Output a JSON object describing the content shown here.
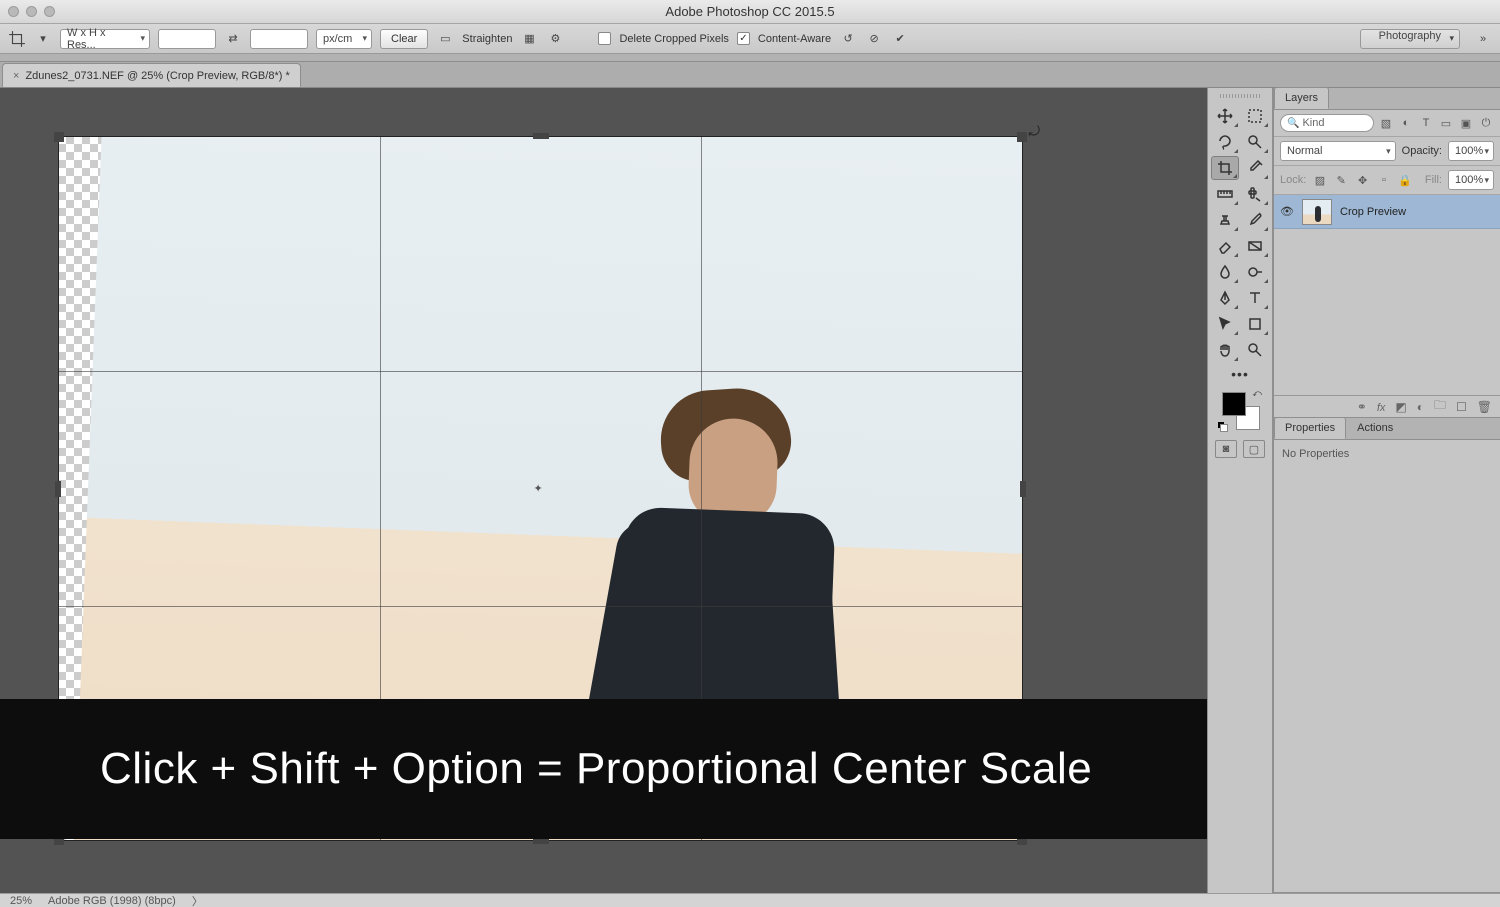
{
  "app": {
    "title": "Adobe Photoshop CC 2015.5"
  },
  "options": {
    "ratio_preset": "W x H x Res...",
    "units": "px/cm",
    "clear": "Clear",
    "straighten": "Straighten",
    "delete_cropped": "Delete Cropped Pixels",
    "content_aware": "Content-Aware",
    "workspace": "Photography"
  },
  "document": {
    "tab_title": "Zdunes2_0731.NEF @ 25% (Crop Preview, RGB/8*) *"
  },
  "layers_panel": {
    "tab": "Layers",
    "filter_placeholder": "Kind",
    "blend_mode": "Normal",
    "opacity_label": "Opacity:",
    "opacity_value": "100%",
    "lock_label": "Lock:",
    "fill_label": "Fill:",
    "fill_value": "100%",
    "layer_name": "Crop Preview"
  },
  "props_panel": {
    "tab_properties": "Properties",
    "tab_actions": "Actions",
    "empty": "No Properties"
  },
  "status": {
    "zoom": "25%",
    "profile": "Adobe RGB (1998) (8bpc)"
  },
  "caption": "Click + Shift + Option = Proportional Center Scale"
}
